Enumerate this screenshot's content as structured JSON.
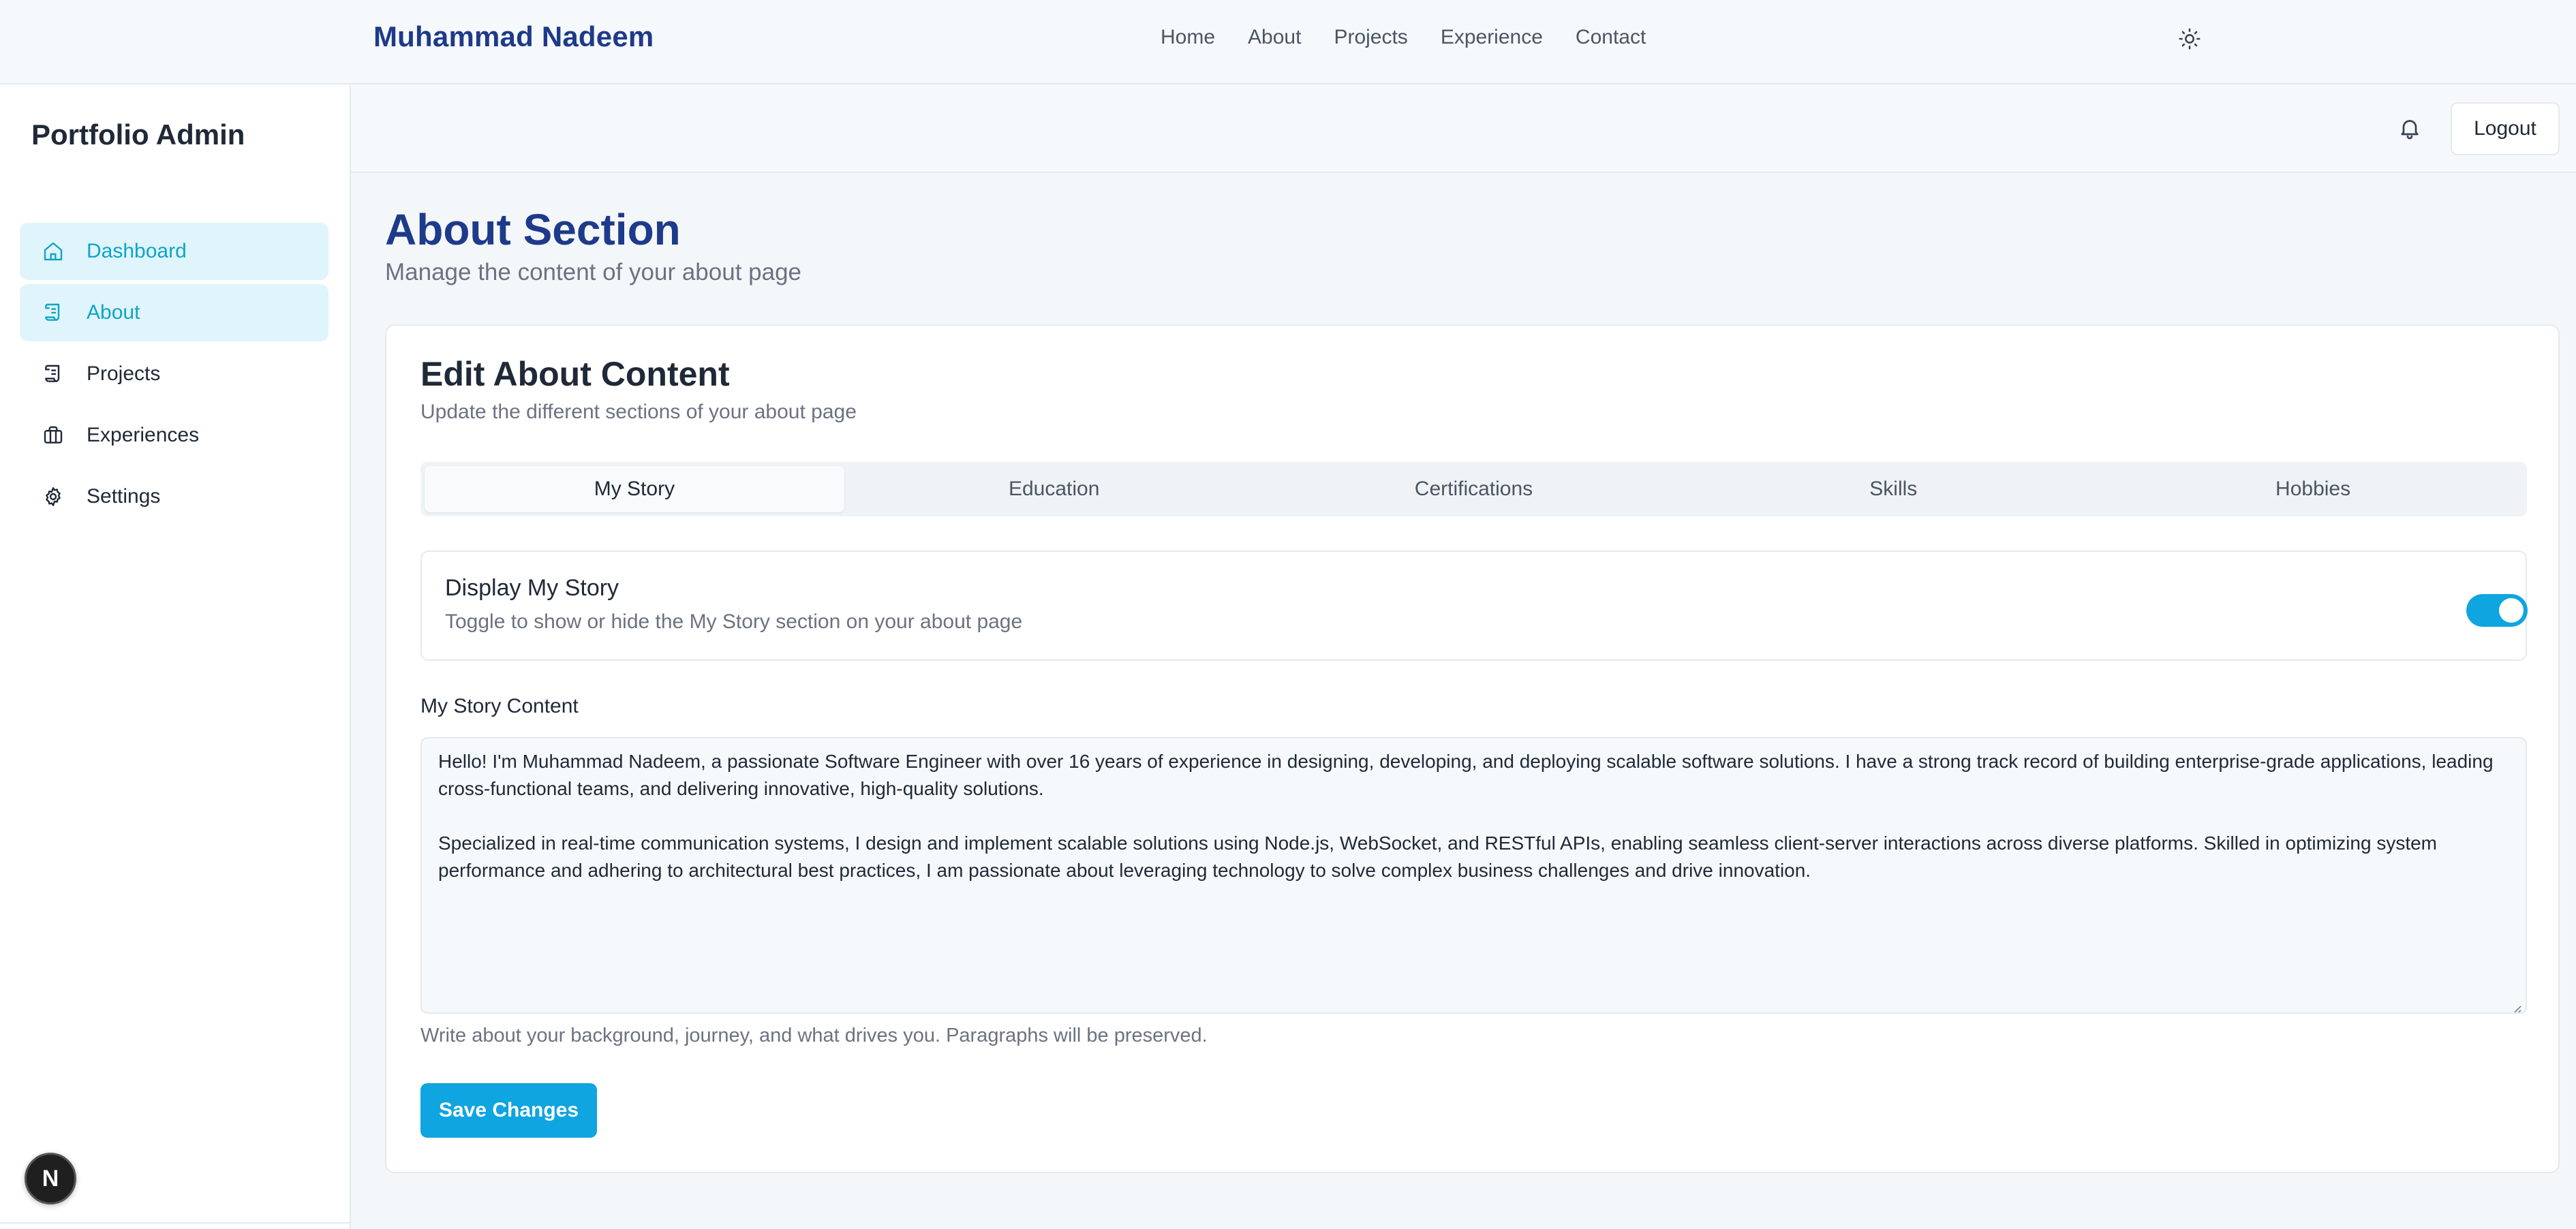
{
  "topnav": {
    "brand": "Muhammad Nadeem",
    "links": [
      "Home",
      "About",
      "Projects",
      "Experience",
      "Contact"
    ],
    "theme_icon": "sun-icon"
  },
  "sidebar": {
    "title": "Portfolio Admin",
    "items": [
      {
        "label": "Dashboard",
        "icon": "home-icon",
        "active": true
      },
      {
        "label": "About",
        "icon": "scroll-icon",
        "active": true
      },
      {
        "label": "Projects",
        "icon": "scroll-icon",
        "active": false
      },
      {
        "label": "Experiences",
        "icon": "briefcase-icon",
        "active": false
      },
      {
        "label": "Settings",
        "icon": "gear-icon",
        "active": false
      }
    ],
    "badge": "N"
  },
  "header": {
    "bell_icon": "bell-icon",
    "logout_label": "Logout"
  },
  "page": {
    "title": "About Section",
    "subtitle": "Manage the content of your about page"
  },
  "card": {
    "title": "Edit About Content",
    "description": "Update the different sections of your about page",
    "tabs": [
      "My Story",
      "Education",
      "Certifications",
      "Skills",
      "Hobbies"
    ],
    "active_tab": "My Story",
    "toggle": {
      "title": "Display My Story",
      "description": "Toggle to show or hide the My Story section on your about page",
      "on": true
    },
    "content_label": "My Story Content",
    "content_value": "Hello! I'm Muhammad Nadeem, a passionate Software Engineer with over 16 years of experience in designing, developing, and deploying scalable software solutions. I have a strong track record of building enterprise-grade applications, leading cross-functional teams, and delivering innovative, high-quality solutions.\n\nSpecialized in real-time communication systems, I design and implement scalable solutions using Node.js, WebSocket, and RESTful APIs, enabling seamless client-server interactions across diverse platforms. Skilled in optimizing system performance and adhering to architectural best practices, I am passionate about leveraging technology to solve complex business challenges and drive innovation.",
    "helper": "Write about your background, journey, and what drives you. Paragraphs will be preserved.",
    "save_label": "Save Changes"
  },
  "colors": {
    "brand": "#1e3a8a",
    "accent": "#0ea5e0",
    "active_bg": "#e0f4fb"
  }
}
